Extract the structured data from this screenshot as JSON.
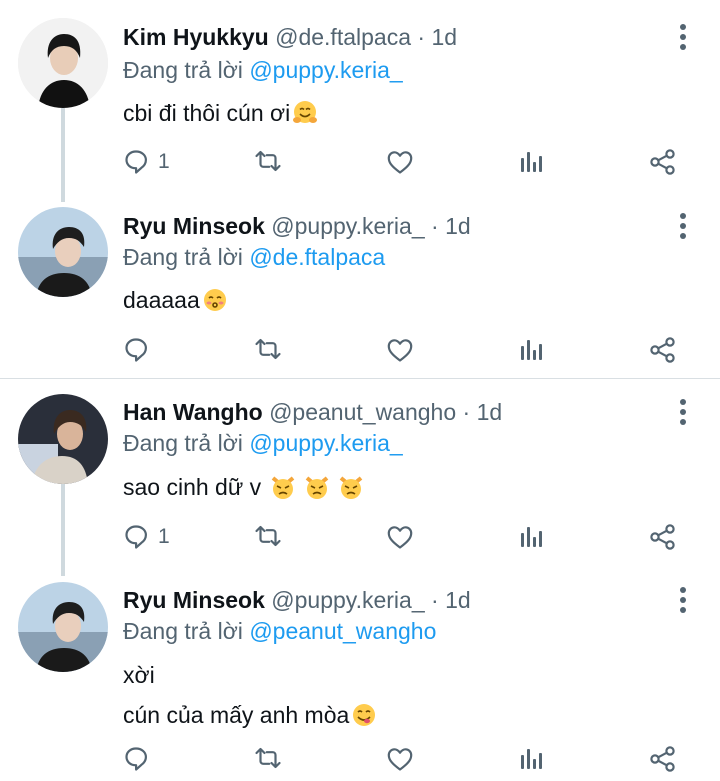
{
  "reply_prefix": "Đang trả lời ",
  "dot": "·",
  "tweets": [
    {
      "name": "Kim Hyukkyu",
      "handle": "@de.ftalpaca",
      "time": "1d",
      "reply_to": "@puppy.keria_",
      "lines": [
        "cbi đi thôi cún ơi"
      ],
      "emoji": "hugging-face",
      "reply_count": "1"
    },
    {
      "name": "Ryu Minseok",
      "handle": "@puppy.keria_",
      "time": "1d",
      "reply_to": "@de.ftalpaca",
      "lines": [
        "daaaaa"
      ],
      "emoji": "kissing-face",
      "reply_count": ""
    },
    {
      "name": "Han Wangho",
      "handle": "@peanut_wangho",
      "time": "1d",
      "reply_to": "@puppy.keria_",
      "lines": [
        "sao cinh dữ v"
      ],
      "emoji": "pouting-cat x3",
      "reply_count": "1"
    },
    {
      "name": "Ryu Minseok",
      "handle": "@puppy.keria_",
      "time": "1d",
      "reply_to": "@peanut_wangho",
      "lines": [
        "xời",
        "cún của mấy anh mòa"
      ],
      "emoji": "face-savoring-food",
      "reply_count": ""
    }
  ],
  "colors": {
    "text": "#0f1419",
    "secondary": "#536471",
    "mention": "#1d9bf0",
    "thread_line": "#cfd9de"
  },
  "icons": [
    "more-vertical-icon",
    "reply-icon",
    "retweet-icon",
    "like-icon",
    "views-icon",
    "share-icon"
  ]
}
